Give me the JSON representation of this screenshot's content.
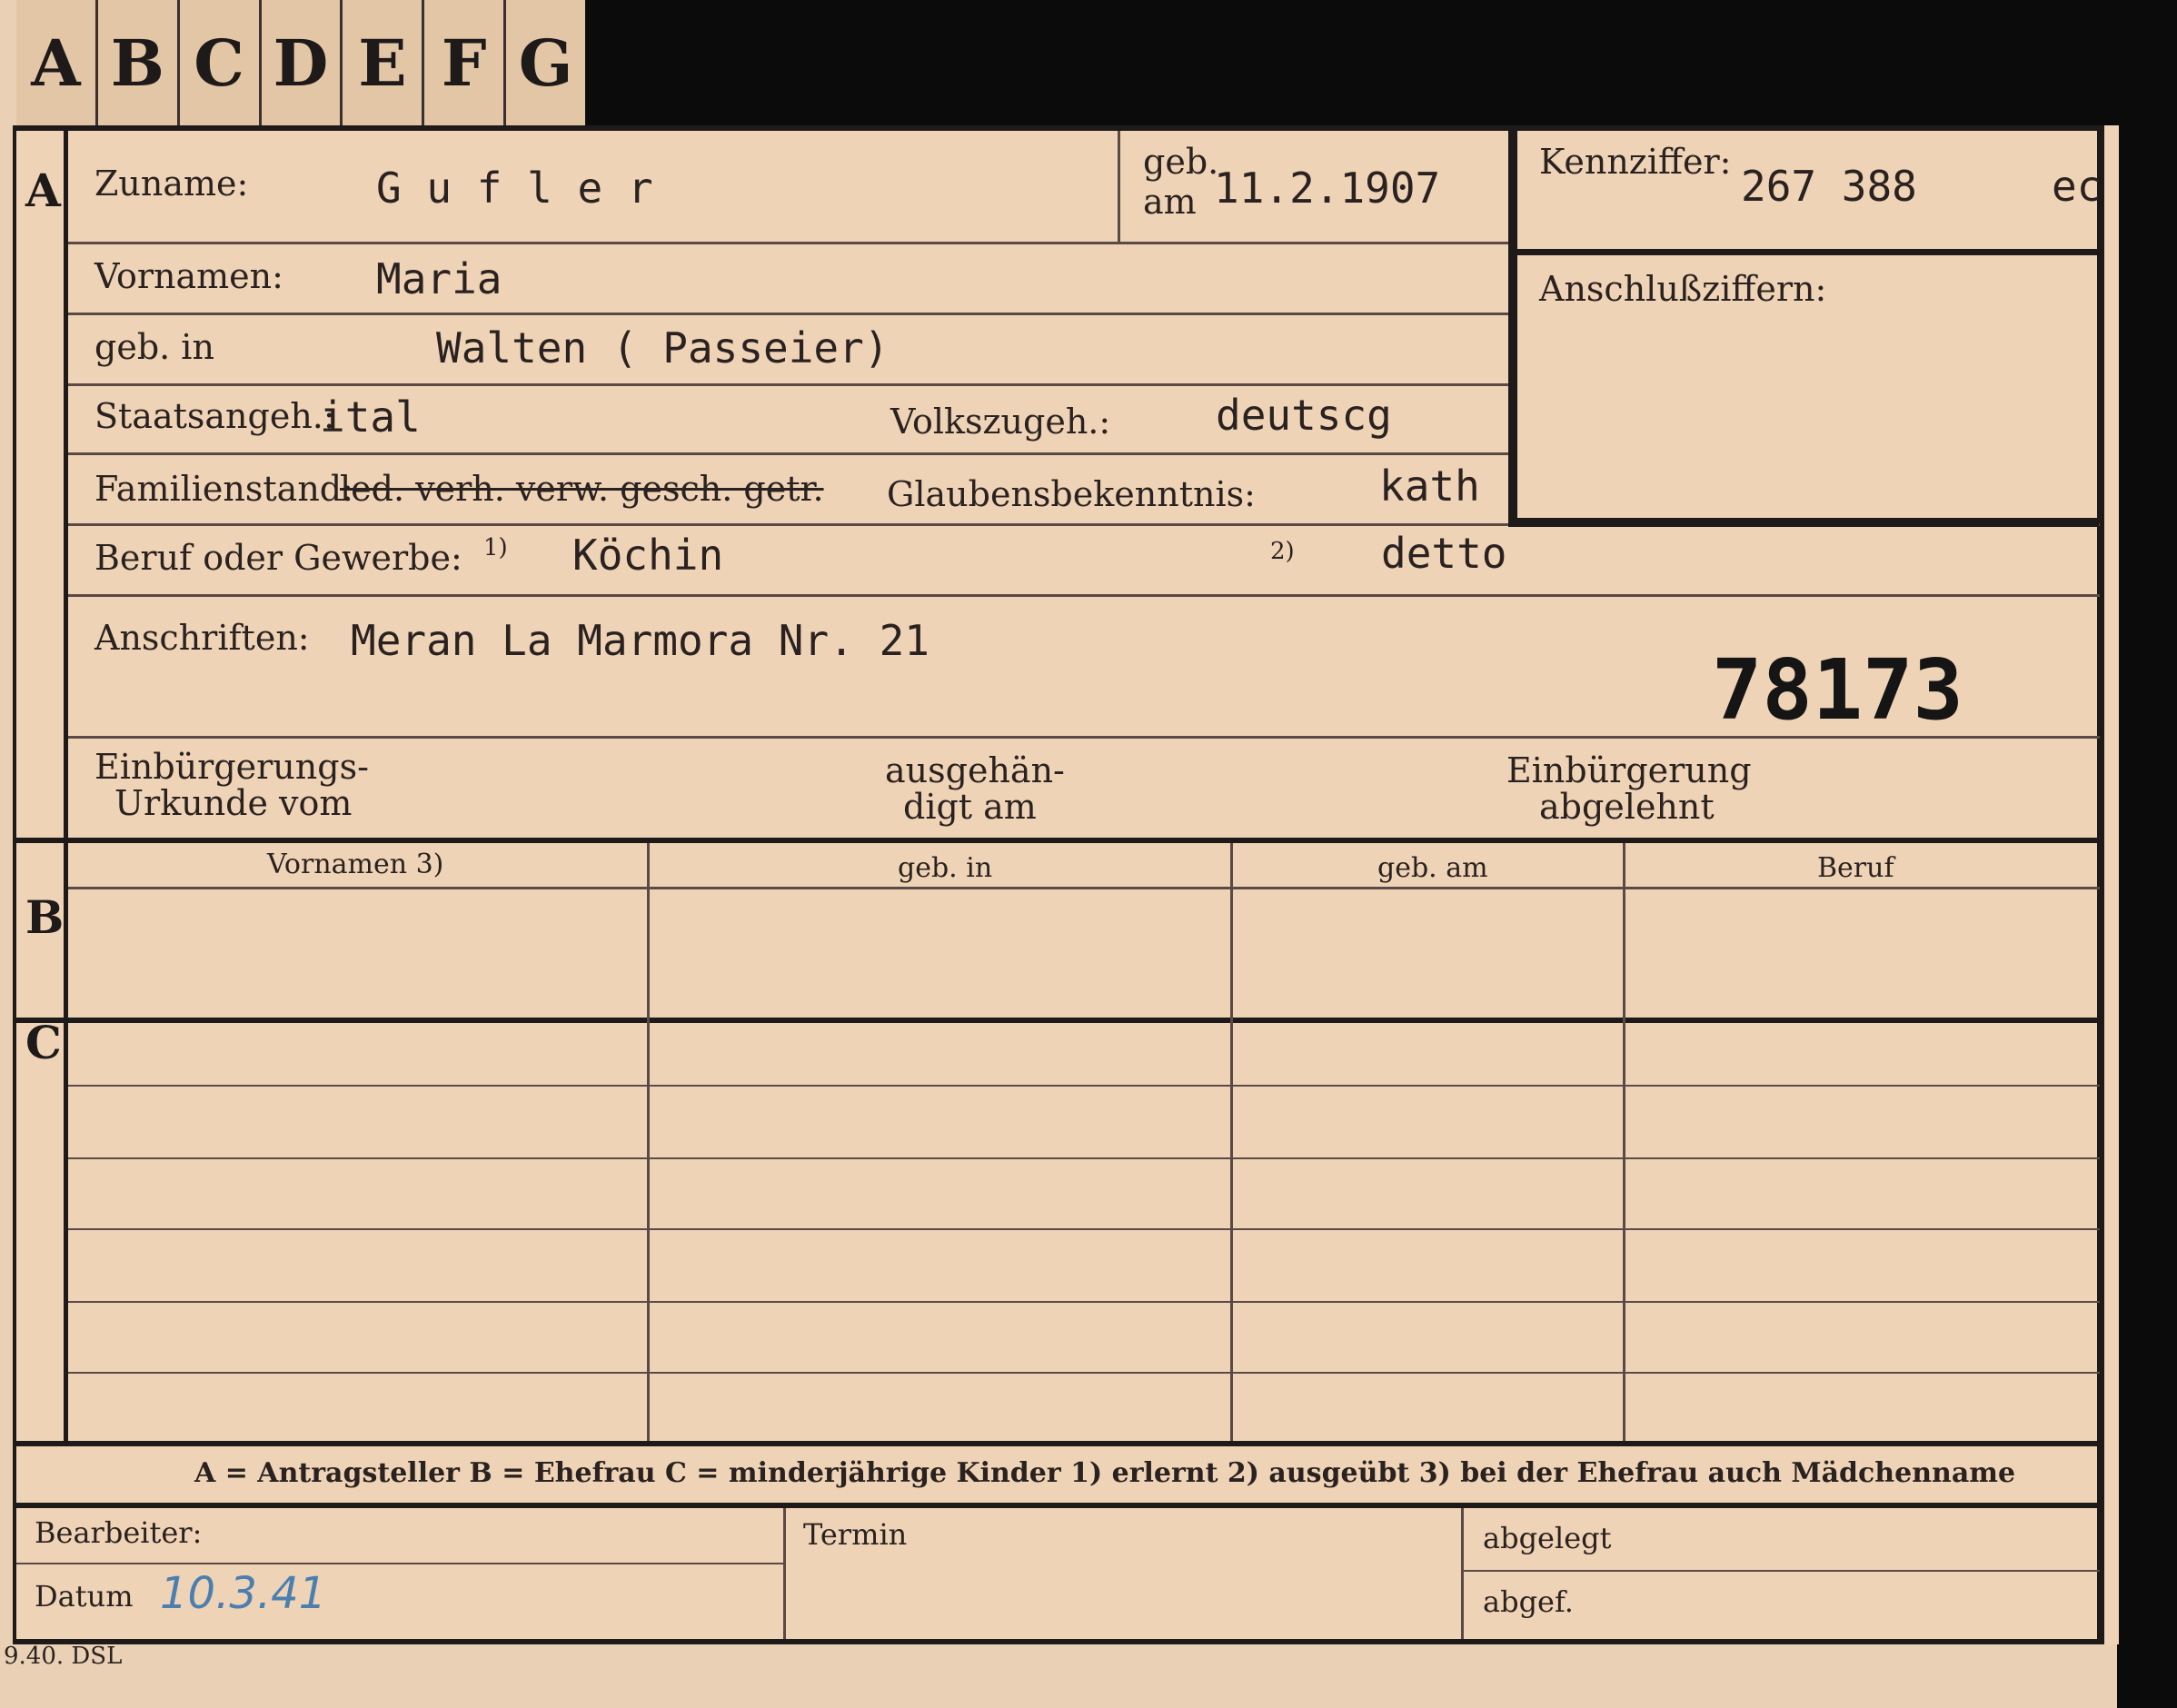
{
  "tabs": [
    "A",
    "B",
    "C",
    "D",
    "E",
    "F",
    "G"
  ],
  "sections": {
    "a": "A",
    "b": "B",
    "c": "C"
  },
  "fields": {
    "zuname_label": "Zuname:",
    "zuname_value": "G u f l e r",
    "geb_am_label_1": "geb.",
    "geb_am_label_2": "am",
    "geb_am_value": "11.2.1907",
    "kennziffer_label": "Kennziffer:",
    "kennziffer_value": "267 388",
    "kennziffer_suffix": "ec",
    "vornamen_label": "Vornamen:",
    "vornamen_value": "Maria",
    "anschluss_label": "Anschlußziffern:",
    "geb_in_label": "geb. in",
    "geb_in_value": "Walten ( Passeier)",
    "staat_label": "Staatsangeh.:",
    "staat_value": "ital",
    "volk_label": "Volkszugeh.:",
    "volk_value": "deutscg",
    "familie_label": "Familienstand:",
    "familie_value": "led. verh. verw. gesch. getr.",
    "glaube_label": "Glaubensbekenntnis:",
    "glaube_value": "kath",
    "beruf_label": "Beruf oder Gewerbe:",
    "beruf_mark1": "1)",
    "beruf_value": "Köchin",
    "beruf_mark2": "2)",
    "beruf_value2": "detto",
    "anschrift_label": "Anschriften:",
    "anschrift_value": "Meran La Marmora Nr. 21",
    "number": "78173",
    "einb_urkunde_1": "Einbürgerungs-",
    "einb_urkunde_2": "Urkunde vom",
    "ausgeh_1": "ausgehän-",
    "ausgeh_2": "digt am",
    "abgelehnt_1": "Einbürgerung",
    "abgelehnt_2": "abgelehnt"
  },
  "table": {
    "headers": [
      "Vornamen 3)",
      "geb. in",
      "geb. am",
      "Beruf"
    ]
  },
  "legend": "A = Antragsteller   B = Ehefrau   C = minderjährige Kinder   1) erlernt   2) ausgeübt   3) bei der Ehefrau auch Mädchenname",
  "footer": {
    "bearbeiter_label": "Bearbeiter:",
    "datum_label": "Datum",
    "datum_value": "10.3.41",
    "termin_label": "Termin",
    "abgelegt_label": "abgelegt",
    "abgefertigt_label": "abgef.",
    "print_code": "9.40. DSL"
  }
}
